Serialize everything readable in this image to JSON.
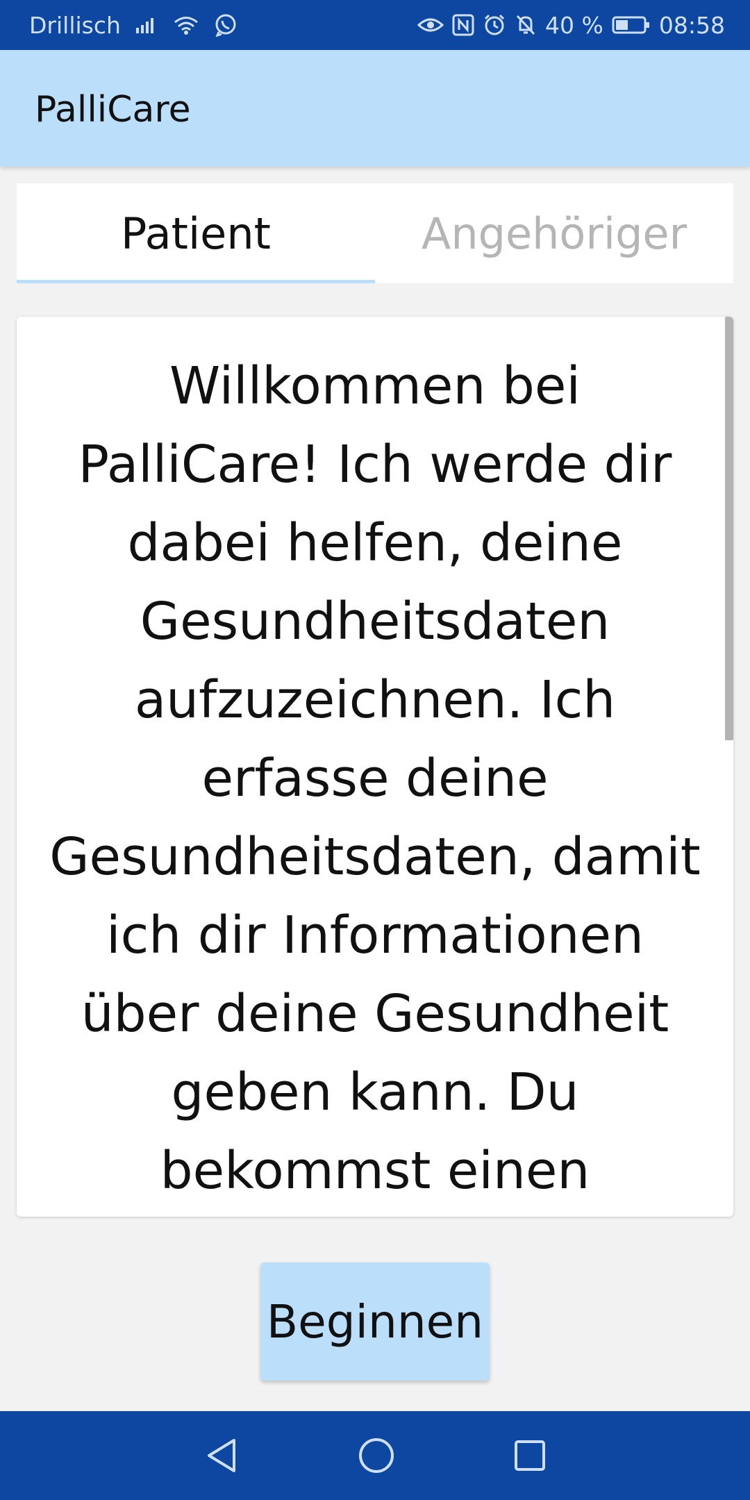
{
  "status_bar": {
    "carrier": "Drillisch",
    "battery": "40 %",
    "time": "08:58",
    "icons_left": [
      "signal-icon",
      "wifi-icon",
      "whatsapp-icon"
    ],
    "icons_right": [
      "eye-icon",
      "nfc-icon",
      "alarm-icon",
      "mute-icon",
      "battery-icon"
    ]
  },
  "app_bar": {
    "title": "PalliCare"
  },
  "tabs": [
    {
      "label": "Patient",
      "active": true
    },
    {
      "label": "Angehöriger",
      "active": false
    }
  ],
  "content": {
    "welcome_text": "Willkommen bei PalliCare! Ich werde dir dabei helfen, deine Gesundheitsdaten aufzuzeichnen. Ich erfasse deine Gesundheitsdaten, damit ich dir Informationen über deine Gesundheit geben kann. Du bekommst einen sofortigen Überblick über deine gemessenen Werte und deinen Gesundheitszustand"
  },
  "actions": {
    "begin_label": "Beginnen"
  },
  "nav_bar": {
    "buttons": [
      "back-icon",
      "home-icon",
      "recents-icon"
    ]
  },
  "colors": {
    "primary_dark": "#0d47a1",
    "primary_light": "#bbdefb"
  }
}
